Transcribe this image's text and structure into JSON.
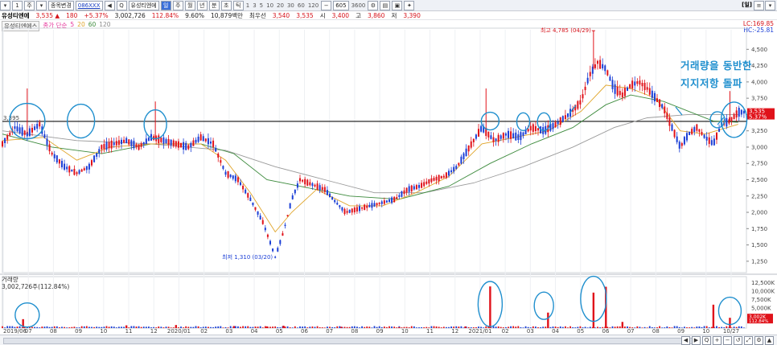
{
  "toolbar": {
    "buttons_left": [
      "▾",
      "1",
      "주",
      "▾"
    ],
    "mode_select": "종목변경",
    "code": "086XXX",
    "stock_select": "유성티엔에",
    "periods": [
      "일",
      "주",
      "월",
      "년",
      "분",
      "초",
      "틱"
    ],
    "intervals": [
      "1",
      "3",
      "5",
      "10",
      "20",
      "30",
      "60",
      "120"
    ],
    "range_value": "605",
    "range_total": "3600",
    "right_label": "[일]"
  },
  "quote": {
    "name": "유성티엔에",
    "price": "3,535",
    "change": "180",
    "change_pct": "+5.37%",
    "volume": "3,002,726",
    "volume_pct": "112.84%",
    "turnover": "9.60%",
    "amount": "10,879백만",
    "preferred_label": "최우선",
    "bid": "3,540",
    "ask": "3,535",
    "open_label": "시",
    "open": "3,400",
    "high_label": "고",
    "high": "3,860",
    "low_label": "저",
    "low": "3,390"
  },
  "price_legend": {
    "name": "유성티엔에스",
    "ma_prefix": "종가 단순",
    "ma": [
      "5",
      "20",
      "60",
      "120"
    ],
    "ma_colors": [
      "#e6339a",
      "#e0a52a",
      "#3c8a3c",
      "#8a8a8a"
    ]
  },
  "right_info": {
    "lc": "LC:169.85",
    "hc": "HC:-25.81"
  },
  "annotation": {
    "line1": "거래량을 동반한",
    "line2": "지지저항 돌파"
  },
  "colors": {
    "up": "#e0121a",
    "down": "#1b3fd6",
    "annotation": "#1f8fce",
    "current_badge": "#e0121a"
  },
  "chart_data": {
    "type": "candlestick",
    "support_level": 3395,
    "support_label": "3,395",
    "high_marker": {
      "label": "최고 4,785 (04/29)",
      "value": 4785
    },
    "low_marker": {
      "label": "최저 1,310 (03/20)",
      "value": 1310
    },
    "current_price_label": "3,535",
    "current_pct_label": "5.37%",
    "ylim": [
      1100,
      4800
    ],
    "y_ticks": [
      1250,
      1500,
      1750,
      2000,
      2250,
      2500,
      2750,
      3000,
      3250,
      3500,
      3750,
      4000,
      4250,
      4500
    ],
    "y_tick_labels": [
      "1,250",
      "1,500",
      "1,750",
      "2,000",
      "2,250",
      "2,500",
      "2,750",
      "3,000",
      "3,250",
      "3,500",
      "3,750",
      "4,000",
      "4,250",
      "4,500"
    ],
    "x_labels": [
      "2019/06",
      "07",
      "08",
      "09",
      "10",
      "11",
      "12",
      "2020/01",
      "02",
      "03",
      "04",
      "05",
      "06",
      "07",
      "08",
      "09",
      "10",
      "11",
      "12",
      "2021/01",
      "02",
      "03",
      "04",
      "05",
      "06",
      "07",
      "08",
      "09",
      "10",
      "10/27"
    ],
    "price_path": [
      [
        0,
        3050
      ],
      [
        3,
        3300
      ],
      [
        6,
        3200
      ],
      [
        9,
        3350
      ],
      [
        12,
        2900
      ],
      [
        15,
        2700
      ],
      [
        18,
        2600
      ],
      [
        21,
        2700
      ],
      [
        24,
        3000
      ],
      [
        27,
        3050
      ],
      [
        30,
        3100
      ],
      [
        33,
        3000
      ],
      [
        36,
        3150
      ],
      [
        39,
        3100
      ],
      [
        42,
        3050
      ],
      [
        45,
        3000
      ],
      [
        48,
        3150
      ],
      [
        51,
        3050
      ],
      [
        54,
        2600
      ],
      [
        57,
        2500
      ],
      [
        60,
        2200
      ],
      [
        63,
        1850
      ],
      [
        65,
        1500
      ],
      [
        66,
        1310
      ],
      [
        68,
        1700
      ],
      [
        70,
        2200
      ],
      [
        72,
        2500
      ],
      [
        74,
        2450
      ],
      [
        76,
        2400
      ],
      [
        78,
        2350
      ],
      [
        80,
        2200
      ],
      [
        83,
        2000
      ],
      [
        86,
        2050
      ],
      [
        89,
        2100
      ],
      [
        92,
        2150
      ],
      [
        95,
        2200
      ],
      [
        98,
        2350
      ],
      [
        101,
        2400
      ],
      [
        104,
        2500
      ],
      [
        107,
        2550
      ],
      [
        110,
        2700
      ],
      [
        113,
        3000
      ],
      [
        116,
        3300
      ],
      [
        119,
        3100
      ],
      [
        122,
        3200
      ],
      [
        125,
        3150
      ],
      [
        128,
        3300
      ],
      [
        131,
        3250
      ],
      [
        134,
        3350
      ],
      [
        137,
        3500
      ],
      [
        140,
        3700
      ],
      [
        142,
        4100
      ],
      [
        144,
        4300
      ],
      [
        146,
        4200
      ],
      [
        148,
        3900
      ],
      [
        150,
        3800
      ],
      [
        152,
        3950
      ],
      [
        154,
        4000
      ],
      [
        156,
        3900
      ],
      [
        158,
        3750
      ],
      [
        160,
        3600
      ],
      [
        162,
        3300
      ],
      [
        164,
        3000
      ],
      [
        166,
        3200
      ],
      [
        168,
        3300
      ],
      [
        170,
        3150
      ],
      [
        172,
        3050
      ],
      [
        174,
        3350
      ],
      [
        176,
        3400
      ],
      [
        178,
        3535
      ]
    ],
    "ma20_path": [
      [
        0,
        3100
      ],
      [
        10,
        3150
      ],
      [
        18,
        2800
      ],
      [
        26,
        3000
      ],
      [
        36,
        3050
      ],
      [
        48,
        3050
      ],
      [
        54,
        2800
      ],
      [
        60,
        2300
      ],
      [
        66,
        1700
      ],
      [
        70,
        2000
      ],
      [
        76,
        2350
      ],
      [
        84,
        2100
      ],
      [
        92,
        2100
      ],
      [
        100,
        2300
      ],
      [
        108,
        2550
      ],
      [
        116,
        3050
      ],
      [
        124,
        3150
      ],
      [
        132,
        3250
      ],
      [
        140,
        3550
      ],
      [
        146,
        3950
      ],
      [
        152,
        3900
      ],
      [
        158,
        3750
      ],
      [
        164,
        3250
      ],
      [
        170,
        3200
      ],
      [
        178,
        3350
      ]
    ],
    "ma60_path": [
      [
        0,
        3200
      ],
      [
        12,
        3000
      ],
      [
        24,
        2900
      ],
      [
        36,
        3050
      ],
      [
        48,
        3050
      ],
      [
        56,
        2900
      ],
      [
        64,
        2500
      ],
      [
        72,
        2400
      ],
      [
        84,
        2250
      ],
      [
        96,
        2200
      ],
      [
        108,
        2400
      ],
      [
        118,
        2750
      ],
      [
        128,
        3050
      ],
      [
        138,
        3300
      ],
      [
        146,
        3650
      ],
      [
        152,
        3800
      ],
      [
        160,
        3700
      ],
      [
        166,
        3550
      ],
      [
        172,
        3400
      ],
      [
        178,
        3380
      ]
    ],
    "ma120_path": [
      [
        0,
        3250
      ],
      [
        18,
        3100
      ],
      [
        36,
        3050
      ],
      [
        54,
        2950
      ],
      [
        66,
        2700
      ],
      [
        78,
        2500
      ],
      [
        90,
        2300
      ],
      [
        102,
        2300
      ],
      [
        114,
        2450
      ],
      [
        126,
        2700
      ],
      [
        138,
        3000
      ],
      [
        148,
        3300
      ],
      [
        156,
        3450
      ],
      [
        166,
        3500
      ],
      [
        178,
        3500
      ]
    ],
    "x_max": 180,
    "volume_legend": {
      "name": "거래량",
      "value": "3,002,726주(112.84%)"
    },
    "volume_ticks": [
      "12,500K",
      "10,000K",
      "7,500K",
      "5,000K",
      "2,500K"
    ],
    "volume_current_label": "3,002K",
    "volume_current_pct": "112.84%",
    "volume_bars": [
      [
        5,
        2600
      ],
      [
        30,
        800
      ],
      [
        42,
        900
      ],
      [
        56,
        600
      ],
      [
        64,
        500
      ],
      [
        68,
        700
      ],
      [
        82,
        400
      ],
      [
        96,
        300
      ],
      [
        112,
        500
      ],
      [
        118,
        12100
      ],
      [
        132,
        4500
      ],
      [
        143,
        10300
      ],
      [
        146,
        12000
      ],
      [
        150,
        1800
      ],
      [
        172,
        6800
      ],
      [
        176,
        3000
      ]
    ],
    "volume_max": 14000,
    "circles_price": [
      [
        6,
        3400,
        22,
        22
      ],
      [
        19,
        3400,
        17,
        21
      ],
      [
        37,
        3350,
        14,
        18
      ],
      [
        118,
        3400,
        11,
        11
      ],
      [
        126,
        3390,
        8,
        11
      ],
      [
        131,
        3390,
        8,
        11
      ],
      [
        173,
        3420,
        9,
        10
      ],
      [
        177,
        3420,
        16,
        22
      ]
    ],
    "circles_volume": [
      [
        6,
        3800,
        15,
        15
      ],
      [
        118,
        7000,
        15,
        28
      ],
      [
        131,
        6500,
        12,
        17
      ],
      [
        143,
        8500,
        16,
        28
      ],
      [
        176,
        5000,
        14,
        17
      ]
    ]
  },
  "bottom": {
    "icons": [
      "◀",
      "▶",
      "Q",
      "+",
      "−",
      "↺",
      "⤢",
      "⚙",
      "▲"
    ]
  }
}
